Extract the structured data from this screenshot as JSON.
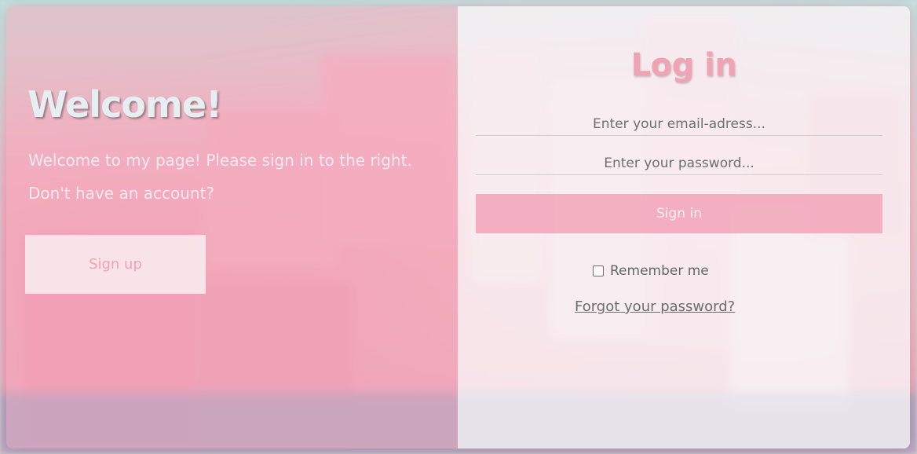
{
  "colors": {
    "accent_pink": "#efa3b4",
    "left_panel_tint": "#f4a0b6",
    "right_panel_tint": "#f8f4f6",
    "signin_button": "#f2a4b8",
    "text_light": "#f4e9ee",
    "text_gray": "#6c6c6c"
  },
  "welcome": {
    "title": "Welcome!",
    "line1": "Welcome to my page! Please sign in to the right.",
    "line2": "Don't have an account?",
    "signup_label": "Sign up"
  },
  "login": {
    "title": "Log in",
    "email_placeholder": "Enter your email-adress...",
    "password_placeholder": "Enter your password...",
    "signin_label": "Sign in",
    "remember_label": "Remember me",
    "forgot_label": "Forgot your password?"
  }
}
